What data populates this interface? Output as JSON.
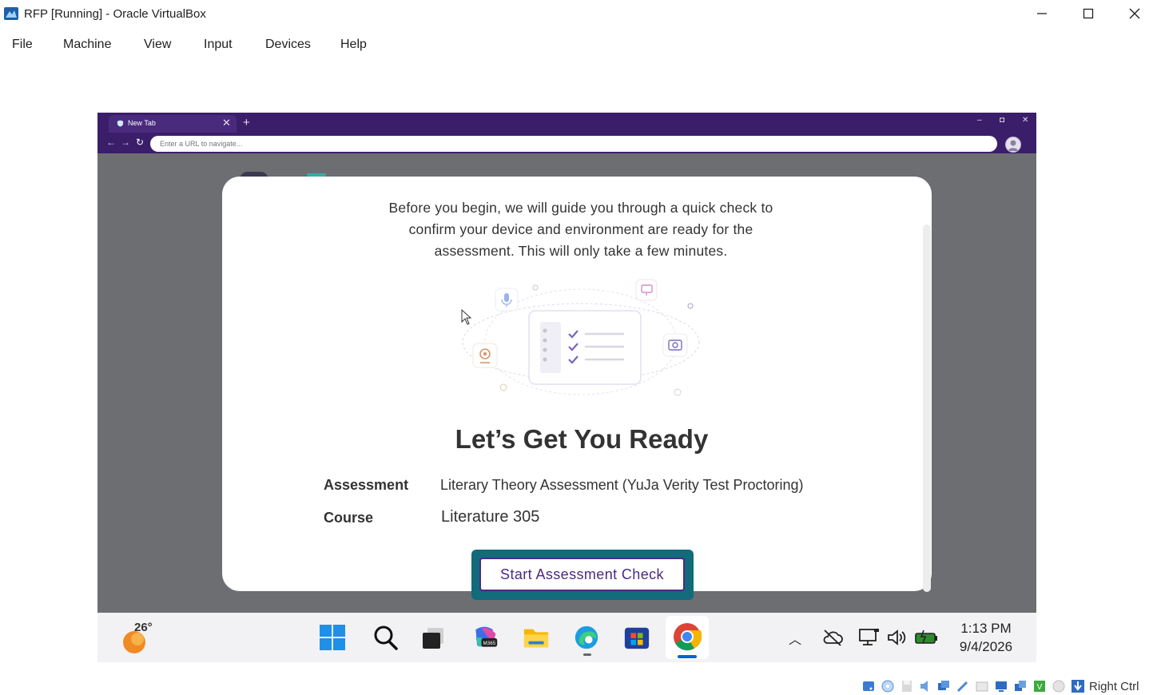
{
  "window": {
    "title": "RFP [Running] - Oracle VirtualBox",
    "controls": [
      "minimize-icon",
      "maximize-icon",
      "close-icon"
    ]
  },
  "menubar": {
    "items": [
      "File",
      "Machine",
      "View",
      "Input",
      "Devices",
      "Help"
    ]
  },
  "browser": {
    "tab_title": "New Tab",
    "address_placeholder": "Enter a URL to navigate...",
    "accent_color": "#3b1e6a"
  },
  "dialog": {
    "intro_lines": [
      "Before you begin, we will guide you through a quick check to",
      "confirm your device and environment are ready for the",
      "assessment. This will only take a few minutes."
    ],
    "heading": "Let’s Get You Ready",
    "assessment_label": "Assessment",
    "assessment_value": "Literary Theory Assessment (YuJa Verity Test Proctoring)",
    "course_label": "Course",
    "course_value": "Literature 305",
    "start_button": "Start Assessment Check",
    "button_color": "#4b2a86",
    "focus_ring_color": "#116b7a"
  },
  "taskbar": {
    "weather_temp": "26°",
    "apps": [
      "start-icon",
      "search-icon",
      "task-view-icon",
      "m365-copilot-icon",
      "file-explorer-icon",
      "edge-icon",
      "store-icon",
      "chrome-icon"
    ],
    "tray": [
      "chevron-up-icon",
      "cloud-off-icon",
      "network-icon",
      "volume-icon",
      "battery-icon"
    ],
    "time": "1:13 PM",
    "date": "9/4/2026"
  },
  "statusbar": {
    "host_key": "Right Ctrl"
  }
}
